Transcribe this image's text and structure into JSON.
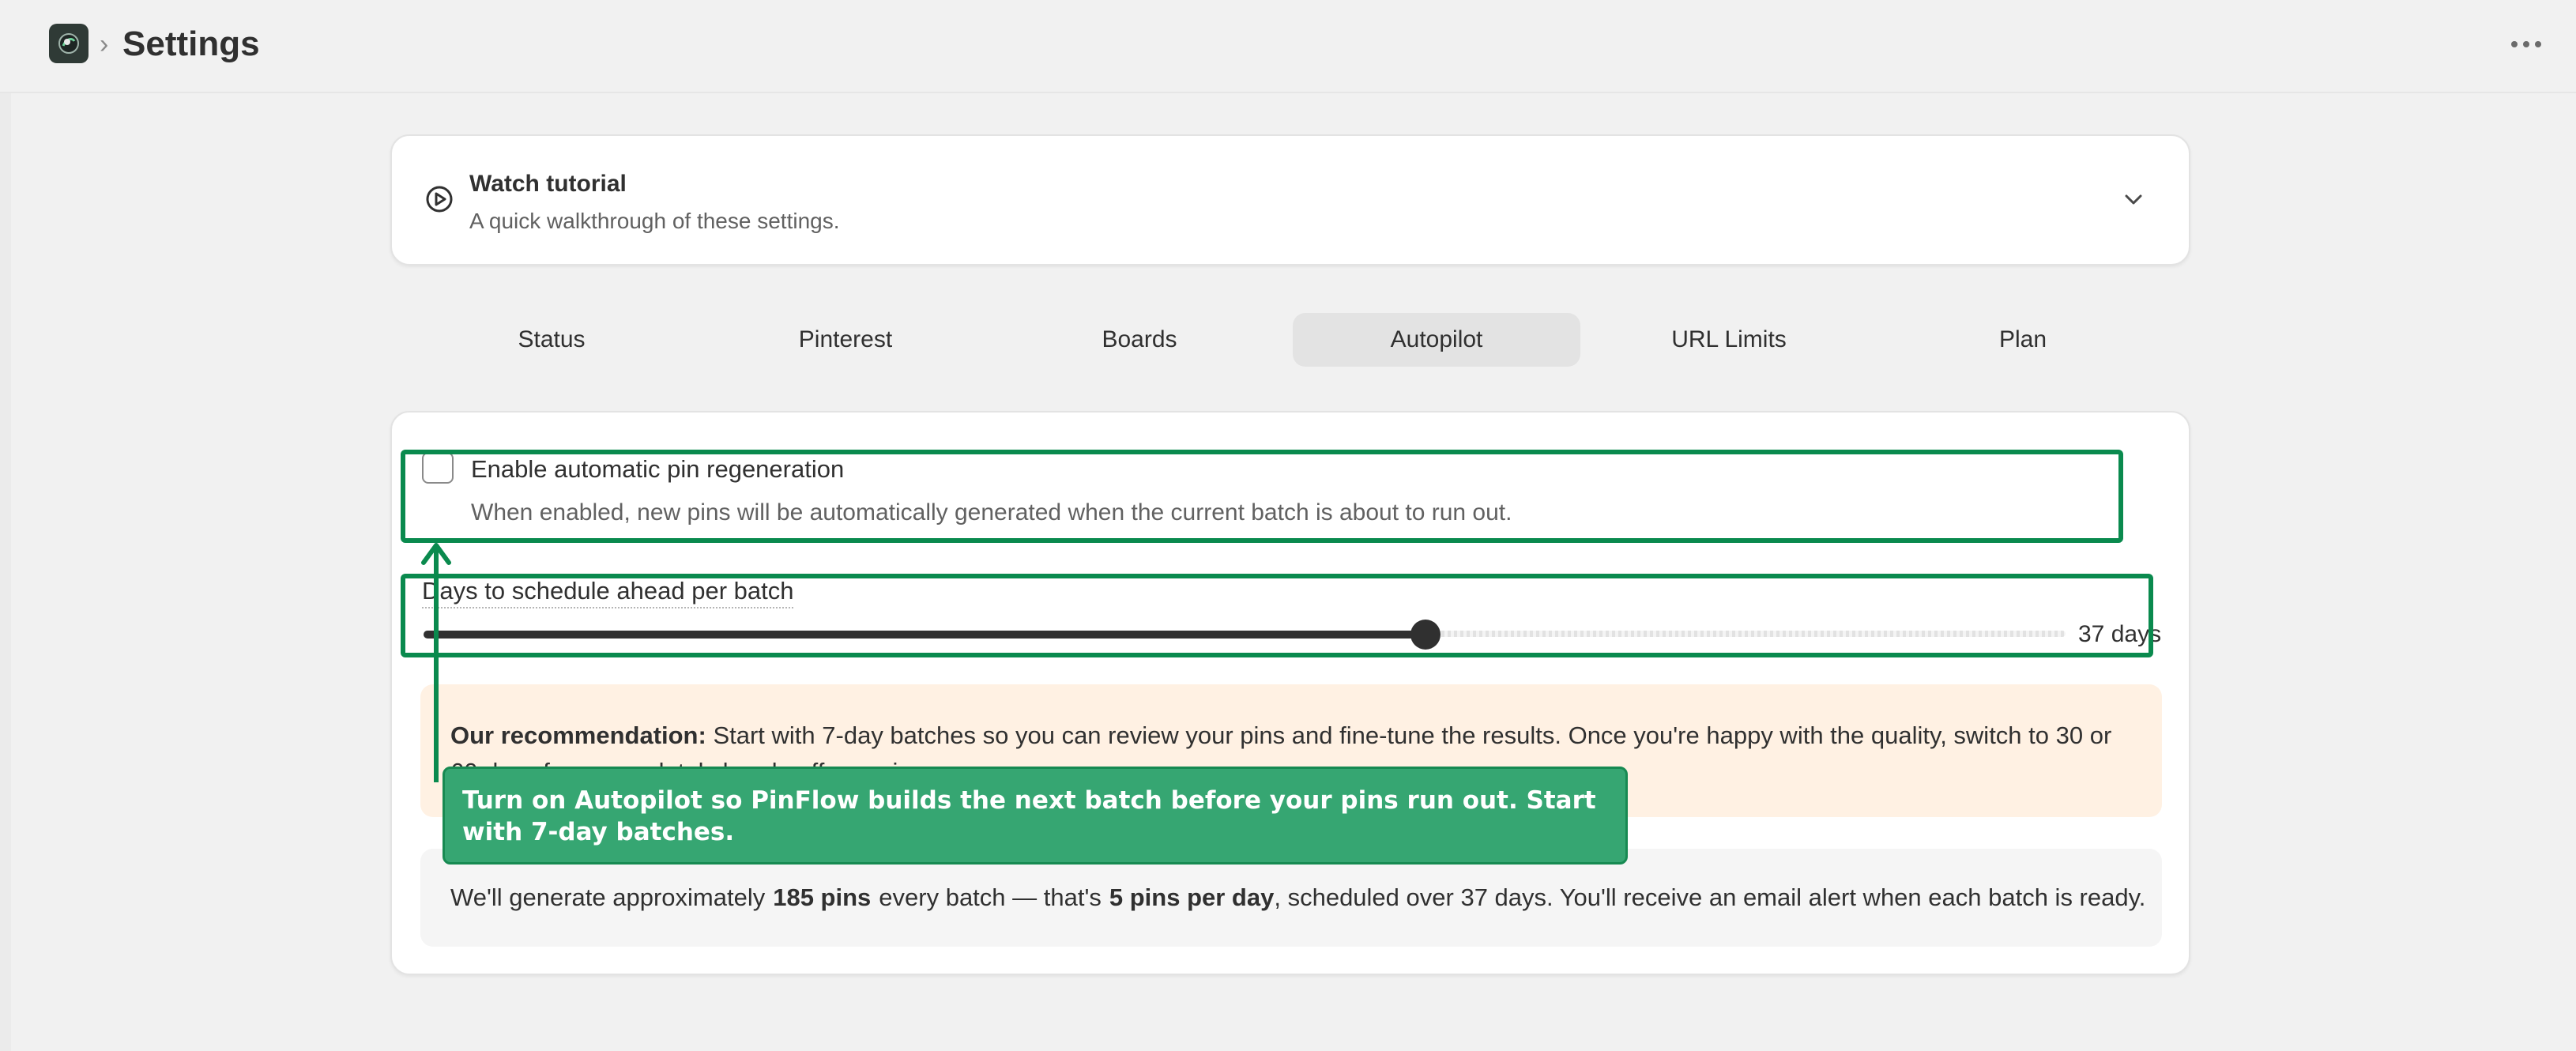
{
  "header": {
    "title": "Settings",
    "breadcrumb_separator": "›",
    "app_icon": "app-logo-icon",
    "more_icon": "more-horizontal-icon"
  },
  "tutorial": {
    "title": "Watch tutorial",
    "subtitle": "A quick walkthrough of these settings.",
    "icon": "play-circle-icon",
    "expanded": false
  },
  "tabs": [
    {
      "label": "Status",
      "active": false
    },
    {
      "label": "Pinterest",
      "active": false
    },
    {
      "label": "Boards",
      "active": false
    },
    {
      "label": "Autopilot",
      "active": true
    },
    {
      "label": "URL Limits",
      "active": false
    },
    {
      "label": "Plan",
      "active": false
    }
  ],
  "autopilot": {
    "checkbox_label": "Enable automatic pin regeneration",
    "checkbox_checked": false,
    "checkbox_help": "When enabled, new pins will be automatically generated when the current batch is about to run out.",
    "slider_label": "Days to schedule ahead per batch",
    "slider": {
      "value": 37,
      "min": 1,
      "max": 60
    },
    "slider_value_text": "37 days"
  },
  "recommendation": {
    "bold": "Our recommendation:",
    "text": "Start with 7-day batches so you can review your pins and fine-tune the results. Once you're happy with the quality, switch to 30 or 60 days for a completely hands-off experience."
  },
  "summary": {
    "p1": "We'll generate approximately",
    "b1": "185 pins",
    "p2": "every batch — that's",
    "b2": "5 pins per day",
    "p3": ", scheduled over 37 days. You'll receive an email alert when each batch is ready."
  },
  "annotation": {
    "text": "Turn on Autopilot so PinFlow builds the next batch before your pins run out. Start with 7-day batches.",
    "color": "#36a672"
  }
}
